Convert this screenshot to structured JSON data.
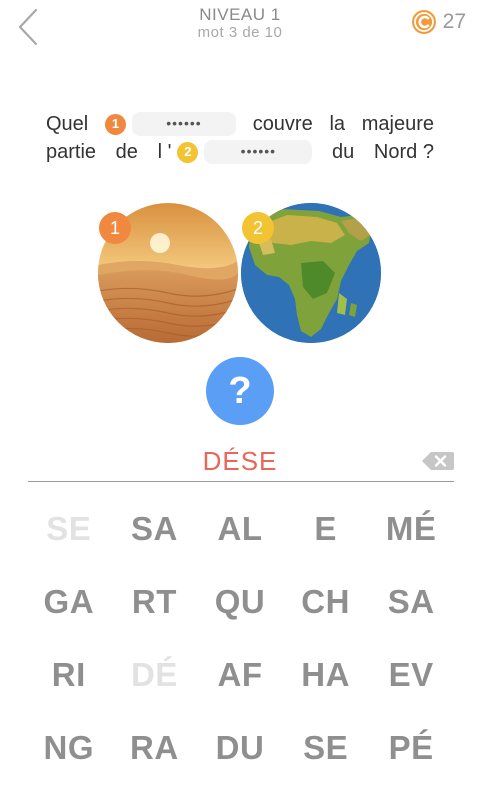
{
  "header": {
    "level_title": "NIVEAU 1",
    "level_subtitle": "mot 3 de 10",
    "coin_count": "27",
    "coin_icon": "coin-c-icon",
    "back_icon": "chevron-left-icon"
  },
  "question": {
    "line1": {
      "word1": "Quel",
      "slot1_number": "1",
      "slot1_dots": "••••••",
      "word2": "couvre",
      "word3": "la",
      "word4": "majeure"
    },
    "line2": {
      "word1": "partie",
      "word2": "de",
      "word3": "l ' ",
      "slot2_number": "2",
      "slot2_dots": "••••••",
      "word4": "du",
      "word5": "Nord ?"
    }
  },
  "images": [
    {
      "badge": "1",
      "subject": "desert-sand-dunes",
      "badge_color": "#f0883f"
    },
    {
      "badge": "2",
      "subject": "africa-map-globe",
      "badge_color": "#f2c332"
    }
  ],
  "hint": {
    "label": "?",
    "color": "#5a9ef5"
  },
  "answer": {
    "text": "DÉSE",
    "color": "#e8675a"
  },
  "keyboard": {
    "keys": [
      {
        "label": "SE",
        "used": true
      },
      {
        "label": "SA",
        "used": false
      },
      {
        "label": "AL",
        "used": false
      },
      {
        "label": "E",
        "used": false
      },
      {
        "label": "MÉ",
        "used": false
      },
      {
        "label": "GA",
        "used": false
      },
      {
        "label": "RT",
        "used": false
      },
      {
        "label": "QU",
        "used": false
      },
      {
        "label": "CH",
        "used": false
      },
      {
        "label": "SA",
        "used": false
      },
      {
        "label": "RI",
        "used": false
      },
      {
        "label": "DÉ",
        "used": true
      },
      {
        "label": "AF",
        "used": false
      },
      {
        "label": "HA",
        "used": false
      },
      {
        "label": "EV",
        "used": false
      },
      {
        "label": "NG",
        "used": false
      },
      {
        "label": "RA",
        "used": false
      },
      {
        "label": "DU",
        "used": false
      },
      {
        "label": "SE",
        "used": false
      },
      {
        "label": "PÉ",
        "used": false
      }
    ]
  }
}
